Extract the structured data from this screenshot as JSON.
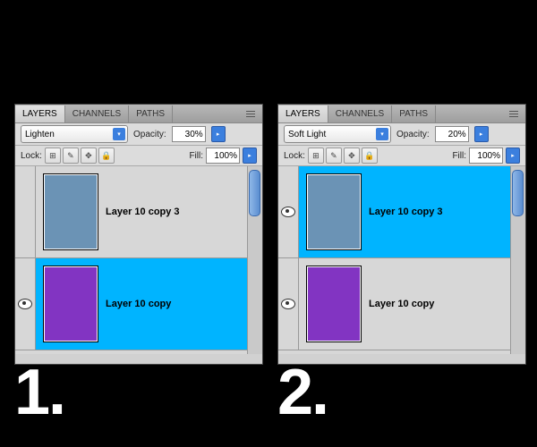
{
  "panel1": {
    "tabs": {
      "layers": "LAYERS",
      "channels": "CHANNELS",
      "paths": "PATHS"
    },
    "blend_mode": "Lighten",
    "opacity_label": "Opacity:",
    "opacity_value": "30%",
    "lock_label": "Lock:",
    "fill_label": "Fill:",
    "fill_value": "100%",
    "layers": [
      {
        "name": "Layer 10 copy 3",
        "visible": false,
        "selected": false,
        "thumb_color": "blue"
      },
      {
        "name": "Layer 10 copy",
        "visible": true,
        "selected": true,
        "thumb_color": "purple"
      }
    ],
    "number": "1."
  },
  "panel2": {
    "tabs": {
      "layers": "LAYERS",
      "channels": "CHANNELS",
      "paths": "PATHS"
    },
    "blend_mode": "Soft Light",
    "opacity_label": "Opacity:",
    "opacity_value": "20%",
    "lock_label": "Lock:",
    "fill_label": "Fill:",
    "fill_value": "100%",
    "layers": [
      {
        "name": "Layer 10 copy 3",
        "visible": true,
        "selected": true,
        "thumb_color": "blue"
      },
      {
        "name": "Layer 10 copy",
        "visible": true,
        "selected": false,
        "thumb_color": "purple"
      }
    ],
    "number": "2."
  }
}
